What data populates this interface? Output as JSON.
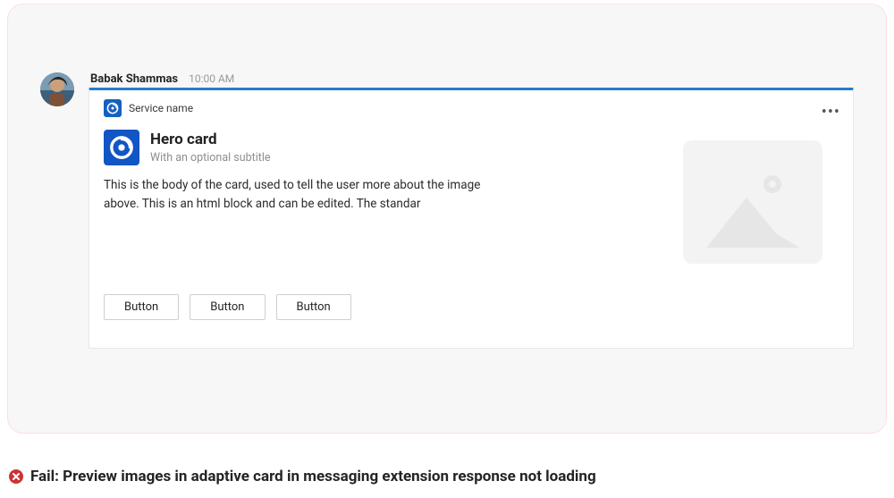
{
  "message": {
    "sender": "Babak Shammas",
    "time": "10:00 AM"
  },
  "card": {
    "service_name": "Service name",
    "title": "Hero card",
    "subtitle": "With an optional subtitle",
    "body": "This is the body of the card, used to tell the user more about the image above. This is an html block and can be edited. The standar",
    "buttons": [
      {
        "label": "Button"
      },
      {
        "label": "Button"
      },
      {
        "label": "Button"
      }
    ]
  },
  "icons": {
    "service": "app-spiral-icon",
    "app": "app-spiral-icon",
    "placeholder": "image-placeholder-icon",
    "more": "more-horizontal-icon",
    "fail": "error-circle-icon"
  },
  "status": {
    "fail_text": "Fail: Preview images in adaptive card in messaging extension response not loading"
  }
}
